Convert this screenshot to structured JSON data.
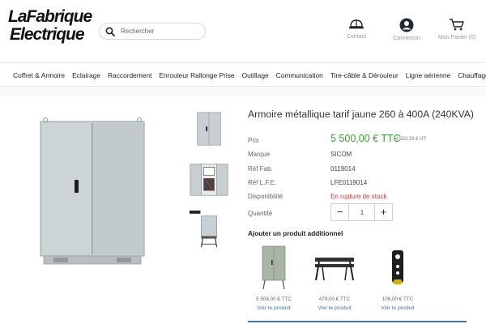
{
  "brand": {
    "line1": "LaFabrique",
    "line2": "Electrique"
  },
  "search": {
    "placeholder": "Rechercher",
    "icon": "search-icon"
  },
  "header_links": [
    {
      "label": "Contact",
      "icon": "hardhat-icon"
    },
    {
      "label": "Connexion",
      "icon": "user-icon"
    },
    {
      "label": "Mon Panier (0)",
      "icon": "cart-icon"
    }
  ],
  "nav": [
    "Coffret & Armoire",
    "Eclairage",
    "Raccordement",
    "Enrouleur Rallonge Prise",
    "Outillage",
    "Communication",
    "Tire-câble & Dérouleur",
    "Ligne aérienne",
    "Chauffage"
  ],
  "product": {
    "title": "Armoire métallique tarif jaune 260 à 400A (240KVA)",
    "price_label": "Prix",
    "price_ttc": "5 500,00 € TTC",
    "price_ht": "4 583,33 € HT",
    "brand_label": "Marque",
    "brand_value": "SICOM",
    "ref_fab_label": "Réf Fab.",
    "ref_fab_value": "0119014",
    "ref_lfe_label": "Réf L.F.E.",
    "ref_lfe_value": "LFE0119014",
    "availability_label": "Disponibilité",
    "availability_value": "En rupture de stock",
    "qty_label": "Quantité",
    "qty_value": "1",
    "qty_minus": "−",
    "qty_plus": "+"
  },
  "addons": {
    "title": "Ajouter un produit additionnel",
    "items": [
      {
        "price": "5 508,00 € TTC",
        "link": "Voir le produit"
      },
      {
        "price": "479,00 € TTC",
        "link": "Voir le produit"
      },
      {
        "price": "106,00 € TTC",
        "link": "Voir le produit"
      }
    ]
  },
  "colors": {
    "price_green": "#3d9b35",
    "stock_red": "#d23a3a",
    "link_blue": "#3b72b8",
    "cabinet_gray": "#c9d0d3"
  }
}
